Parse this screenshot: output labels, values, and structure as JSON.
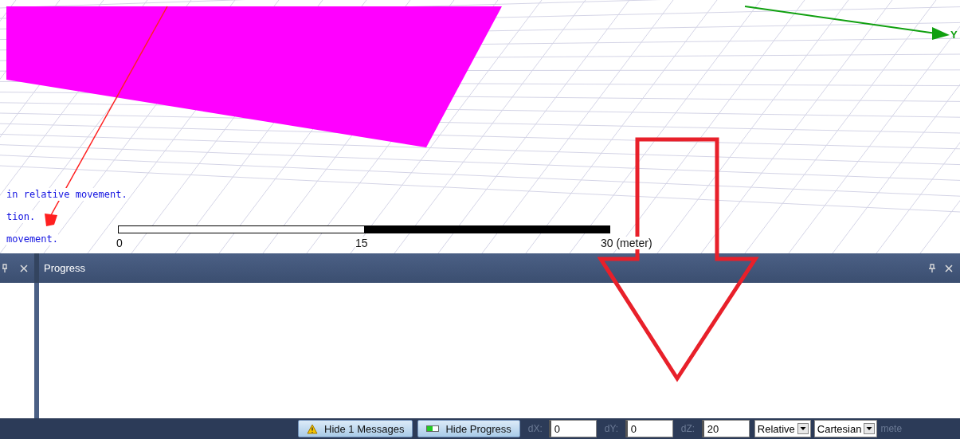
{
  "viewport": {
    "console_lines": [
      "in relative movement.",
      "tion.",
      "movement."
    ],
    "axis_label": "Y",
    "scale_bar": {
      "labels": [
        "0",
        "15",
        "30 (meter)"
      ]
    }
  },
  "progress_panel": {
    "title": "Progress"
  },
  "status_bar": {
    "buttons": [
      {
        "label": "Hide 1 Messages",
        "kind": "warning"
      },
      {
        "label": "Hide Progress",
        "kind": "progress"
      }
    ],
    "coords": [
      {
        "label": "dX:",
        "value": "0"
      },
      {
        "label": "dY:",
        "value": "0"
      },
      {
        "label": "dZ:",
        "value": "20"
      }
    ],
    "dropdowns": [
      "Relative",
      "Cartesian"
    ],
    "units": "mete"
  }
}
